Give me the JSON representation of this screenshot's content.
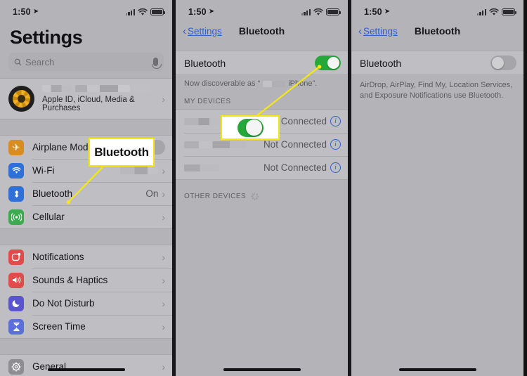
{
  "statusbar": {
    "time": "1:50",
    "location_icon": "location-arrow-icon",
    "signal_icon": "cellular-signal-icon",
    "wifi_icon": "wifi-icon",
    "battery_icon": "battery-icon"
  },
  "colors": {
    "toggle_on": "#26a739",
    "toggle_off": "#a5a5aa",
    "callout_border": "#f5e614",
    "link_blue": "#2f5fd0",
    "panel_bg": "#b4b4b8",
    "group_bg": "#bfbfc3"
  },
  "panel1": {
    "title": "Settings",
    "search": {
      "placeholder": "Search",
      "icon": "search-icon",
      "mic_icon": "microphone-icon"
    },
    "account": {
      "name_redacted": "",
      "subtitle": "Apple ID, iCloud, Media & Purchases",
      "avatar_icon": "sunflower-avatar"
    },
    "group1": [
      {
        "label": "Airplane Mode",
        "icon": "airplane-icon",
        "icon_color": "#d98c20",
        "control": "toggle",
        "toggle": "off"
      },
      {
        "label": "Wi-Fi",
        "icon": "wifi-icon",
        "icon_color": "#2f6fd8",
        "control": "value-blur",
        "value": ""
      },
      {
        "label": "Bluetooth",
        "icon": "bluetooth-icon",
        "icon_color": "#2f6fd8",
        "control": "value",
        "value": "On"
      },
      {
        "label": "Cellular",
        "icon": "cellular-icon",
        "icon_color": "#3caa4e",
        "control": "chevron",
        "value": ""
      }
    ],
    "group2": [
      {
        "label": "Notifications",
        "icon": "notifications-icon",
        "icon_color": "#e24b4b",
        "control": "chevron"
      },
      {
        "label": "Sounds & Haptics",
        "icon": "sounds-icon",
        "icon_color": "#e24b4b",
        "control": "chevron"
      },
      {
        "label": "Do Not Disturb",
        "icon": "moon-icon",
        "icon_color": "#5a55cf",
        "control": "chevron"
      },
      {
        "label": "Screen Time",
        "icon": "hourglass-icon",
        "icon_color": "#5a6fd8",
        "control": "chevron"
      }
    ],
    "group3": [
      {
        "label": "General",
        "icon": "gear-icon",
        "icon_color": "#8d8d92",
        "control": "chevron"
      }
    ],
    "callout": {
      "text": "Bluetooth",
      "points_to": "bluetooth-row"
    }
  },
  "panel2": {
    "nav": {
      "back_label": "Settings",
      "title": "Bluetooth",
      "back_icon": "chevron-left-icon"
    },
    "bluetooth_row": {
      "label": "Bluetooth",
      "toggle": "on"
    },
    "discoverable_prefix": "Now discoverable as “",
    "discoverable_suffix": "iPhone”.",
    "my_devices_header": "MY DEVICES",
    "devices": [
      {
        "name_redacted": "",
        "status": "Not Connected",
        "info_icon": "info-circle-icon"
      },
      {
        "name_redacted": "",
        "status": "Not Connected",
        "info_icon": "info-circle-icon"
      },
      {
        "name_redacted": "",
        "status": "Not Connected",
        "info_icon": "info-circle-icon"
      }
    ],
    "other_devices_header": "OTHER DEVICES",
    "other_devices_spinner": "loading-spinner-icon",
    "callout": {
      "content": "toggle-on",
      "points_to": "bluetooth-master-toggle"
    }
  },
  "panel3": {
    "nav": {
      "back_label": "Settings",
      "title": "Bluetooth",
      "back_icon": "chevron-left-icon"
    },
    "bluetooth_row": {
      "label": "Bluetooth",
      "toggle": "off"
    },
    "description": "AirDrop, AirPlay, Find My, Location Services, and Exposure Notifications use Bluetooth."
  }
}
